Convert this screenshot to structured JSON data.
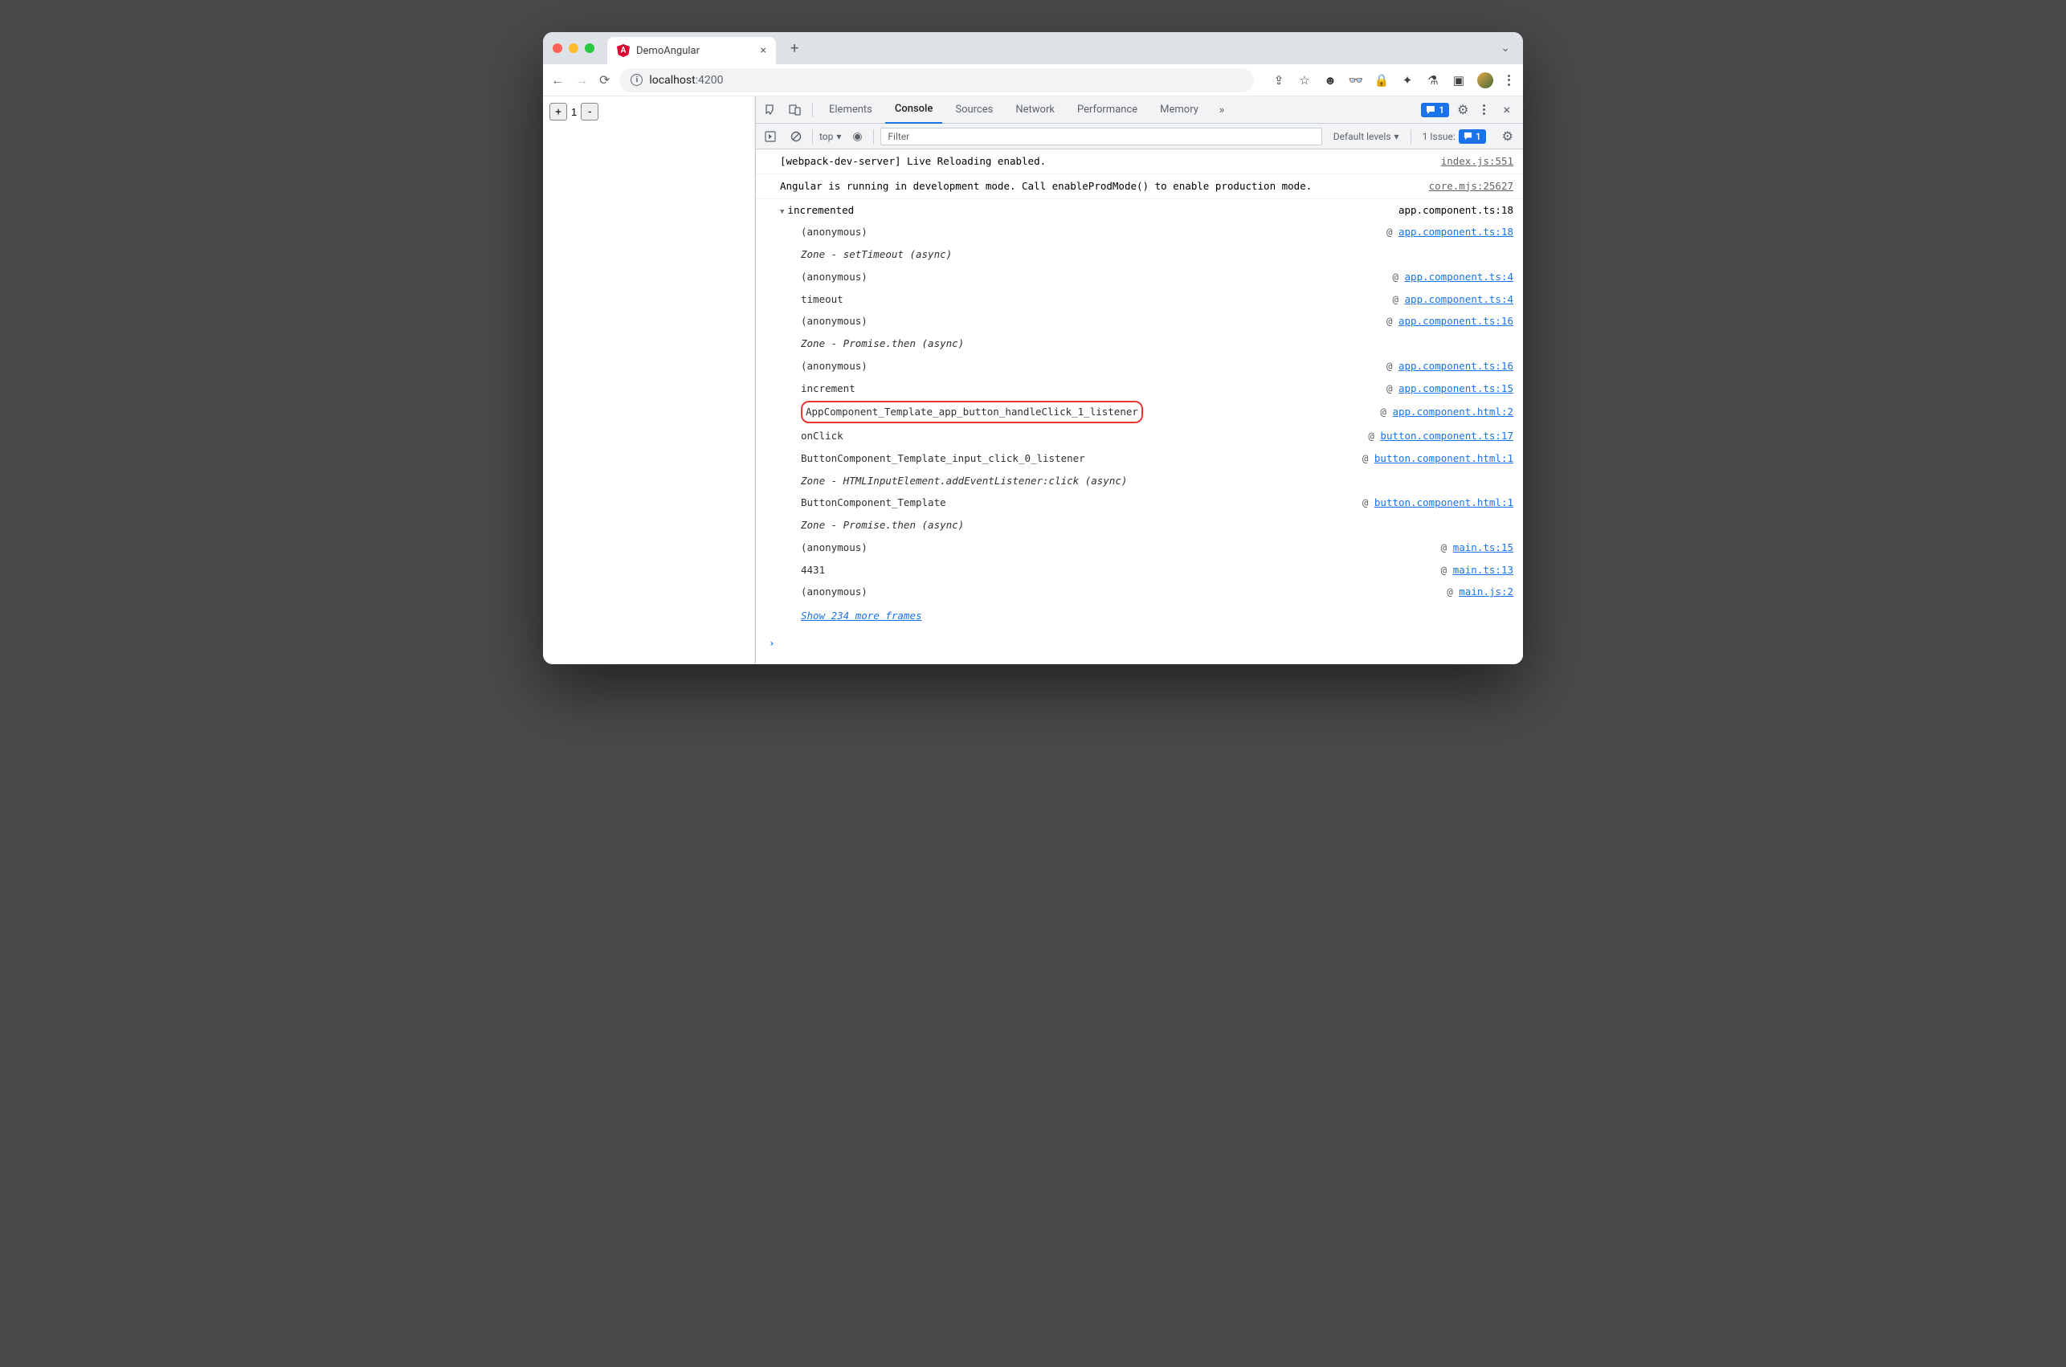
{
  "browser": {
    "tab_title": "DemoAngular",
    "url_host": "localhost",
    "url_path": ":4200"
  },
  "page": {
    "counter_value": "1"
  },
  "devtools": {
    "tabs": [
      "Elements",
      "Console",
      "Sources",
      "Network",
      "Performance",
      "Memory"
    ],
    "active_tab": "Console",
    "msg_count": "1",
    "toolbar": {
      "context": "top",
      "filter_placeholder": "Filter",
      "levels": "Default levels",
      "issues_label": "1 Issue:",
      "issues_count": "1"
    }
  },
  "console": {
    "msg1": {
      "text": "[webpack-dev-server] Live Reloading enabled.",
      "src": "index.js:551"
    },
    "msg2": {
      "text": "Angular is running in development mode. Call enableProdMode() to enable production mode.",
      "src": "core.mjs:25627"
    },
    "group": {
      "label": "incremented",
      "src": "app.component.ts:18"
    },
    "trace": {
      "l1": {
        "fn": "(anonymous)",
        "loc": "app.component.ts:18"
      },
      "z1": "Zone - setTimeout (async)",
      "l2": {
        "fn": "(anonymous)",
        "loc": "app.component.ts:4"
      },
      "l3": {
        "fn": "timeout",
        "loc": "app.component.ts:4"
      },
      "l4": {
        "fn": "(anonymous)",
        "loc": "app.component.ts:16"
      },
      "z2": "Zone - Promise.then (async)",
      "l5": {
        "fn": "(anonymous)",
        "loc": "app.component.ts:16"
      },
      "l6": {
        "fn": "increment",
        "loc": "app.component.ts:15"
      },
      "l7": {
        "fn": "AppComponent_Template_app_button_handleClick_1_listener",
        "loc": "app.component.html:2"
      },
      "l8": {
        "fn": "onClick",
        "loc": "button.component.ts:17"
      },
      "l9": {
        "fn": "ButtonComponent_Template_input_click_0_listener",
        "loc": "button.component.html:1"
      },
      "z3": "Zone - HTMLInputElement.addEventListener:click (async)",
      "l10": {
        "fn": "ButtonComponent_Template",
        "loc": "button.component.html:1"
      },
      "z4": "Zone - Promise.then (async)",
      "l11": {
        "fn": "(anonymous)",
        "loc": "main.ts:15"
      },
      "l12": {
        "fn": "4431",
        "loc": "main.ts:13"
      },
      "l13": {
        "fn": "(anonymous)",
        "loc": "main.js:2"
      }
    },
    "show_more": "Show 234 more frames",
    "at": "@"
  }
}
